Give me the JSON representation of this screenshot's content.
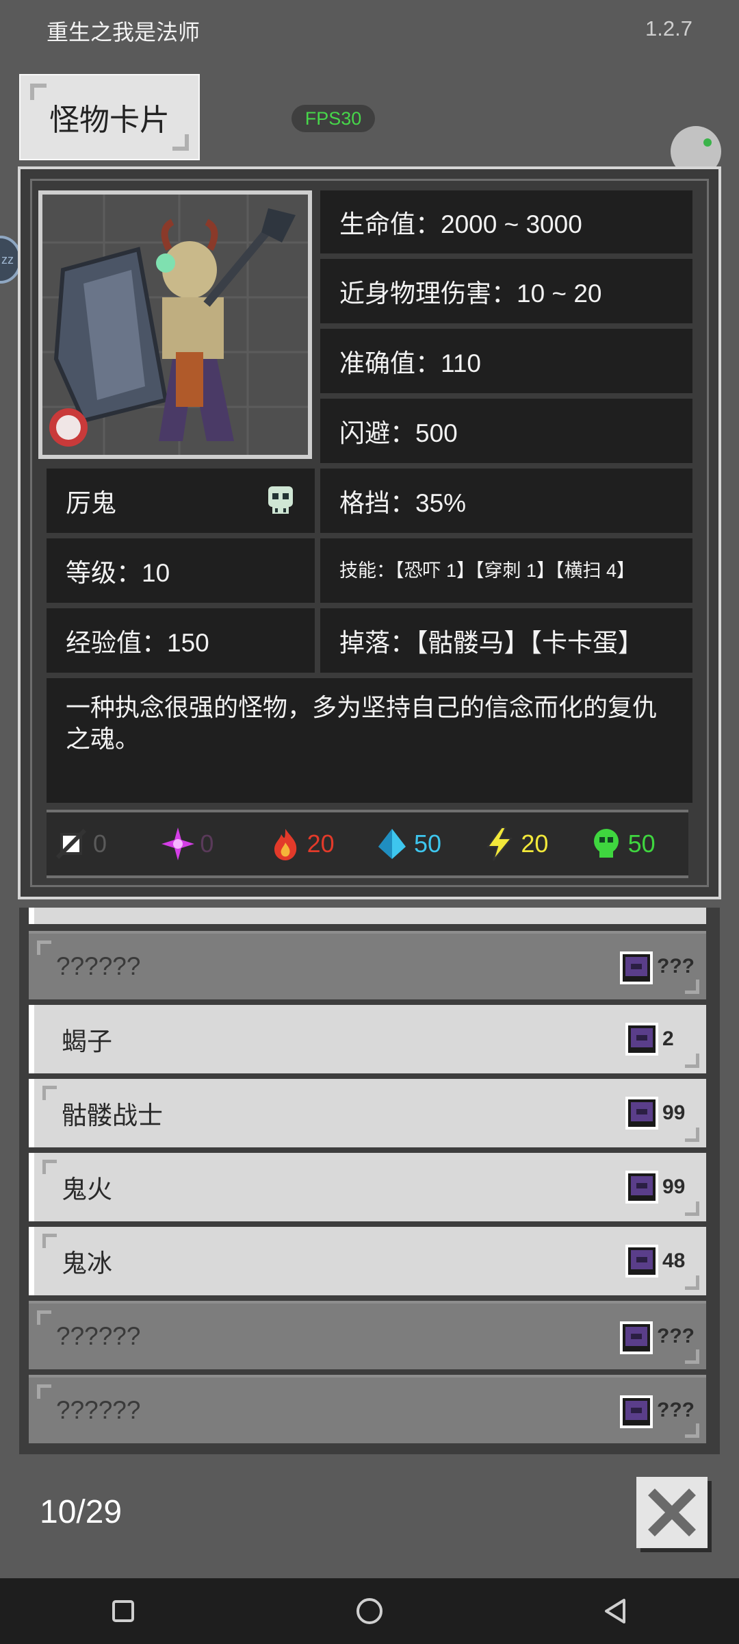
{
  "app": {
    "title": "重生之我是法师",
    "version": "1.2.7"
  },
  "header": {
    "title": "怪物卡片",
    "fps": "FPS30"
  },
  "monster": {
    "name": "厉鬼",
    "level": "等级：10",
    "exp": "经验值：150",
    "hp": "生命值：2000 ~ 3000",
    "melee": "近身物理伤害：10 ~ 20",
    "accuracy": "准确值：110",
    "dodge": "闪避：500",
    "block": "格挡：35%",
    "skills": "技能：【恐吓 1】【穿刺 1】【横扫 4】",
    "drops": "掉落：【骷髅马】【卡卡蛋】",
    "description": "一种执念很强的怪物，多为坚持自己的信念而化的复仇之魂。"
  },
  "resistances": [
    {
      "icon": "physical-icon",
      "value": "0",
      "color": "#5a5a5a"
    },
    {
      "icon": "arcane-icon",
      "value": "0",
      "color": "#5a3a5a"
    },
    {
      "icon": "fire-icon",
      "value": "20",
      "color": "#e23a2a"
    },
    {
      "icon": "water-icon",
      "value": "50",
      "color": "#3ec6ee"
    },
    {
      "icon": "lightning-icon",
      "value": "20",
      "color": "#f2e83a"
    },
    {
      "icon": "poison-icon",
      "value": "50",
      "color": "#3fd63f"
    }
  ],
  "list": [
    {
      "label": "??????",
      "count": "???",
      "state": "unknown"
    },
    {
      "label": "蝎子",
      "count": "2",
      "state": "known"
    },
    {
      "label": "骷髅战士",
      "count": "99",
      "state": "known"
    },
    {
      "label": "鬼火",
      "count": "99",
      "state": "known"
    },
    {
      "label": "鬼冰",
      "count": "48",
      "state": "known"
    },
    {
      "label": "??????",
      "count": "???",
      "state": "unknown"
    },
    {
      "label": "??????",
      "count": "???",
      "state": "unknown"
    }
  ],
  "footer": {
    "page": "10/29"
  }
}
